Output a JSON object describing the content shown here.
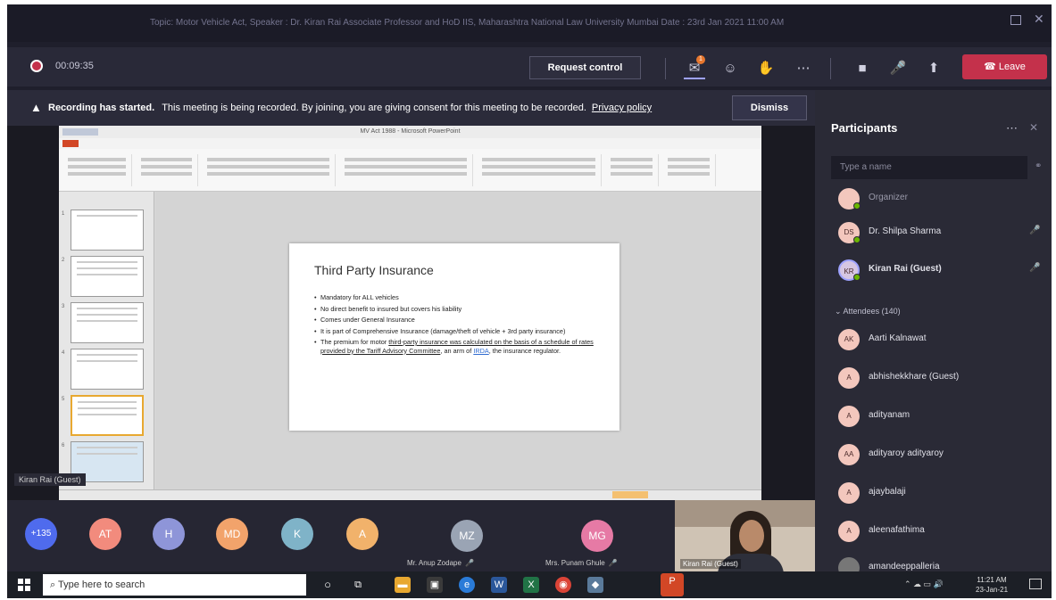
{
  "window": {
    "title": "Topic: Motor Vehicle Act, Speaker : Dr. Kiran Rai Associate Professor and HoD IIS, Maharashtra National Law University Mumbai Date : 23rd Jan 2021 11:00 AM"
  },
  "toolbar": {
    "timer": "00:09:35",
    "request_control": "Request control",
    "leave": "Leave",
    "chat_badge": "1",
    "icons": [
      "chat-icon",
      "reactions-icon",
      "raise-hand-icon",
      "more-icon",
      "camera-off-icon",
      "mic-off-icon",
      "share-icon"
    ]
  },
  "banner": {
    "bold": "Recording has started.",
    "text": "This meeting is being recorded. By joining, you are giving consent for this meeting to be recorded.",
    "privacy": "Privacy policy",
    "dismiss": "Dismiss"
  },
  "presentation": {
    "app_title": "MV Act 1988 - Microsoft PowerPoint",
    "slide_title": "Third Party Insurance",
    "bullets": [
      "Mandatory for ALL vehicles",
      "No direct benefit to insured but covers his liability",
      "Comes under General Insurance",
      "It is part of Comprehensive Insurance (damage/theft of vehicle + 3rd party insurance)"
    ],
    "last_bullet_pre": "The premium for motor",
    "last_bullet_underlined": "third-party insurance was calculated on the basis of a schedule of rates provided by the Tariff Advisory Committee",
    "last_bullet_mid": ", an arm of",
    "last_bullet_link": "IRDA",
    "last_bullet_post": ", the insurance regulator.",
    "presenter_tag": "Kiran Rai (Guest)"
  },
  "strip": {
    "overflow": "+135",
    "avatars": [
      {
        "initials": "AT",
        "color": "#f28b7d"
      },
      {
        "initials": "H",
        "color": "#8e95d8"
      },
      {
        "initials": "MD",
        "color": "#f2a36b"
      },
      {
        "initials": "K",
        "color": "#7fb3c8"
      },
      {
        "initials": "A",
        "color": "#f1b26b"
      }
    ],
    "tiles": [
      {
        "initials": "MZ",
        "name": "Mr. Anup Zodape",
        "color": "#9aa4b4"
      },
      {
        "initials": "MG",
        "name": "Mrs. Punam Ghule",
        "color": "#e67aa5"
      }
    ],
    "video_name": "Kiran Rai (Guest)"
  },
  "participants": {
    "title": "Participants",
    "search_placeholder": "Type a name",
    "attendees_label": "Attendees (140)",
    "presenters": [
      {
        "initials": "",
        "name": "Organizer"
      },
      {
        "initials": "DS",
        "name": "Dr. Shilpa Sharma"
      },
      {
        "initials": "KR",
        "name": "Kiran Rai (Guest)"
      }
    ],
    "attendees": [
      {
        "initials": "AK",
        "name": "Aarti Kalnawat"
      },
      {
        "initials": "A",
        "name": "abhishekkhare (Guest)"
      },
      {
        "initials": "A",
        "name": "adityanam"
      },
      {
        "initials": "AA",
        "name": "adityaroy adityaroy"
      },
      {
        "initials": "A",
        "name": "ajaybalaji"
      },
      {
        "initials": "A",
        "name": "aleenafathima"
      },
      {
        "initials": "",
        "name": "amandeeppalleria"
      }
    ]
  },
  "taskbar": {
    "search_placeholder": "Type here to search",
    "time": "11:21 AM",
    "date": "23-Jan-21"
  }
}
